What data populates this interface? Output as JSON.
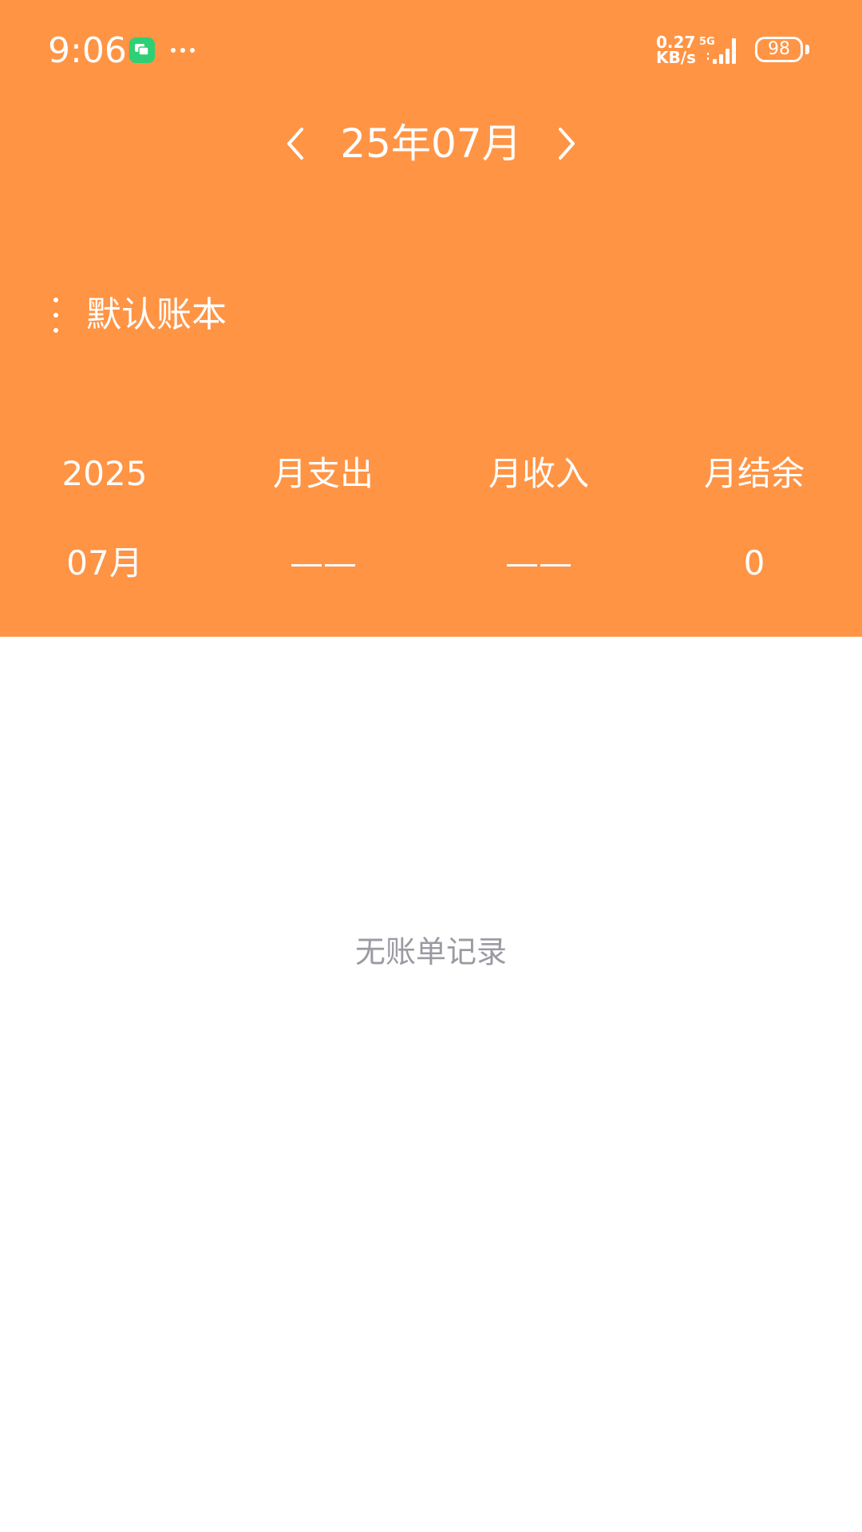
{
  "status_bar": {
    "time": "9:06",
    "net_speed_value": "0.27",
    "net_speed_unit": "KB/s",
    "network_type": "5G",
    "battery_level": "98"
  },
  "header": {
    "month_title": "25年07月",
    "ledger_name": "默认账本",
    "accent_color": "#ff9445"
  },
  "summary": {
    "year": "2025",
    "month": "07月",
    "expense_label": "月支出",
    "expense_value": "——",
    "income_label": "月收入",
    "income_value": "——",
    "balance_label": "月结余",
    "balance_value": "0"
  },
  "empty_state": {
    "text": "无账单记录"
  }
}
